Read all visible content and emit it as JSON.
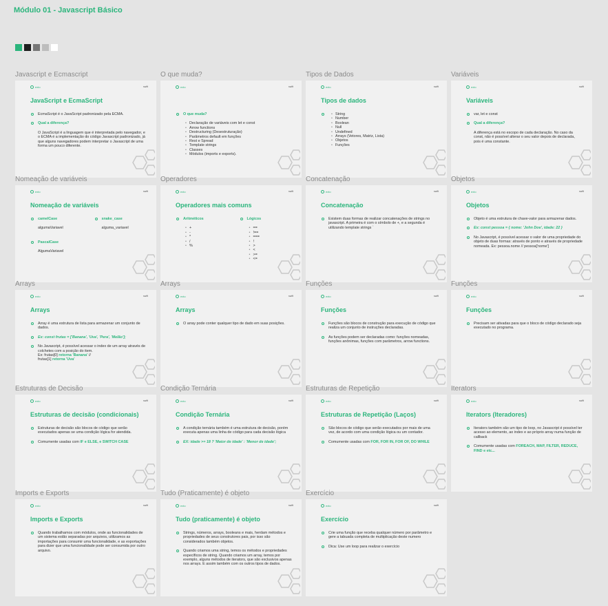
{
  "page_title": "Módulo 01 - Javascript Básico",
  "swatches": [
    "#2bb57c",
    "#1e1e1e",
    "#777777",
    "#bdbdbd",
    "#ffffff"
  ],
  "logo_text": "exto",
  "brand_text": "swift",
  "slides": [
    {
      "label": "Javascript e Ecmascript",
      "title": "JavaScript e EcmaScript"
    },
    {
      "label": "O que muda?",
      "title": ""
    },
    {
      "label": "Tipos de Dados",
      "title": "Tipos de dados"
    },
    {
      "label": "Variáveis",
      "title": "Variáveis"
    },
    {
      "label": "Nomeação de variáveis",
      "title": "Nomeação de variáveis"
    },
    {
      "label": "Operadores",
      "title": "Operadores mais comuns"
    },
    {
      "label": "Concatenação",
      "title": "Concatenação"
    },
    {
      "label": "Objetos",
      "title": "Objetos"
    },
    {
      "label": "Arrays",
      "title": "Arrays"
    },
    {
      "label": "Arrays",
      "title": "Arrays"
    },
    {
      "label": "Funções",
      "title": "Funções"
    },
    {
      "label": "Funções",
      "title": "Funções"
    },
    {
      "label": "Estruturas de Decisão",
      "title": "Estruturas de decisão (condicionais)"
    },
    {
      "label": "Condição Ternária",
      "title": "Condição Ternária"
    },
    {
      "label": "Estruturas de Repetição",
      "title": "Estruturas de Repetição (Laços)"
    },
    {
      "label": "Iterators",
      "title": "Iterators (Iteradores)"
    },
    {
      "label": "Imports e Exports",
      "title": "Imports e Exports"
    },
    {
      "label": "Tudo (Praticamente) é objeto",
      "title": "Tudo (praticamente) é objeto"
    },
    {
      "label": "Exercício",
      "title": "Exercício"
    }
  ],
  "c": {
    "s0a": "EcmaScript é o JavaScript padronizado pela ECMA.",
    "s0b": "Qual a diferença?",
    "s0c": "O JavaScript é a linguagem que é interpretada pelo navegador, e o ECMA é a implementação do código Javascript padronizado, já que alguns navegadores podem interpretar o Javascript de uma forma um pouco diferente.",
    "s1a": "O que muda?",
    "s1items": [
      "Declaração de variáveis com let e const",
      "Arrow functions",
      "Destructuring (Desestruturação)",
      "Parâmetros default em funções",
      "Rest e Spread",
      "Template strings",
      "Classes",
      "Módulos (imports e exports)."
    ],
    "s2items": [
      "String",
      "Number",
      "Boolean",
      "Null",
      "Undefined",
      "Arrays (Vetores, Matriz, Lista)",
      "Objetos",
      "Funções"
    ],
    "s3a": "var, let e const",
    "s3b": "Qual a diferença?",
    "s3c": "A diferença está no escopo de cada declaração. No caso da const, não é possível alterar o seu valor depois de declarada, pois é uma constante.",
    "s4a": "camelCase",
    "s4b": "algumaVariavel",
    "s4c": "snake_case",
    "s4d": "alguma_variavel",
    "s4e": "PascalCase",
    "s4f": "AlgumaVariavel",
    "s5a": "Aritméticos",
    "s5aitems": [
      "+",
      "-",
      "*",
      "/",
      "%"
    ],
    "s5b": "Lógicos",
    "s5bitems": [
      "==",
      "!==",
      "===",
      "!",
      "&gt;",
      "&lt;",
      "&gt;=",
      "&lt;="
    ],
    "s6a": "Existem duas formas de realizar concatenações de strings no javascript. A primeira é com o símbolo de +, e a segunda é utilizando template strings `",
    "s7a": "Objeto é uma estrutura de chave-valor para armazenar dados.",
    "s7b": "Ex: const pessoa = { nome: 'John Doe', idade: 22 }",
    "s7c": "No Javascript, é possível acessar o valor de uma propriedade do objeto de duas formas: através de ponto e através de propriedade nomeada. Ex: pessoa.nome // pessoa['nome']",
    "s8a": "Array é uma estrutura de lista para armazenar um conjunto de dados.",
    "s8b": "Ex: const frutas = ['Banana', 'Uva', 'Pera', 'Melão'];",
    "s8c": "No Javascript, é possível acessar o index de um array através de colchetes com a posição do item.",
    "s8d1": "Ex: frutas[0] ",
    "s8d2": "retorna 'Banana'",
    "s8d3": " //",
    "s8e1": "frutas[1] ",
    "s8e2": "retorna 'Uva'",
    "s9a": "O array pode conter qualquer tipo de dado em suas posições.",
    "s10a": "Funções são blocos de construção para execução de código que realiza um conjunto de instruções declaradas.",
    "s10b": "As funções podem ser declaradas como: funções nomeadas, funções anônimas, funções com parâmetros, arrow functions.",
    "s11a": "Precisam ser ativadas para que o bloco de código declarado seja executado no programa.",
    "s12a": "Estruturas de decisão são blocos de código que serão executados apenas se uma condição lógica for atendida.",
    "s12b1": "Comumente usadas com ",
    "s12b2": "IF e ELSE, e SWITCH CASE",
    "s13a": "A condição ternária também é uma estrutura de decisão, porém executa apenas uma linha de código para cada decisão lógica",
    "s13b": "EX: idade >= 18 ? 'Maior de idade' : 'Menor de idade';",
    "s14a": "São blocos de código que serão executados por mais de uma vez, de acordo com uma condição lógica ou um contador.",
    "s14b1": "Comumente usadas com ",
    "s14b2": "FOR, FOR IN, FOR OF, DO WHILE",
    "s15a": "Iterators também são um tipo de loop, no Javascript é possível ter acesso ao elemento, ao index e ao próprio array numa função de callback",
    "s15b1": "Comumente usadas com ",
    "s15b2": "FOREACH, MAP, FILTER, REDUCE, FIND e etc...",
    "s16a": "Quando trabalhamos com módulos, onde as funcionalidades de um sistema estão separadas por arquivos, utilizamos as importações para consumir uma funcionalidade, e as exportações para dizer que uma funcionalidade pode ser consumida por outro arquivo.",
    "s17a": "Strings, números, arrays, booleans e mais, herdam métodos e propriedades de seus construtores pais, por isso são considerados também objetos.",
    "s17b": "Quando criamos uma string, temos os métodos e propriedades específicos de string. Quando criamos um array, temos por exemplo, alguns métodos de iterators, que são exclusivos apenas nos arrays. E assim também com os outros tipos de dados.",
    "s18a": "Crie uma função que receba qualquer número por parâmetro e gere a tabuada completa de multiplicação deste numero",
    "s18b": "Dica: Use um loop para realizar o exercício"
  }
}
